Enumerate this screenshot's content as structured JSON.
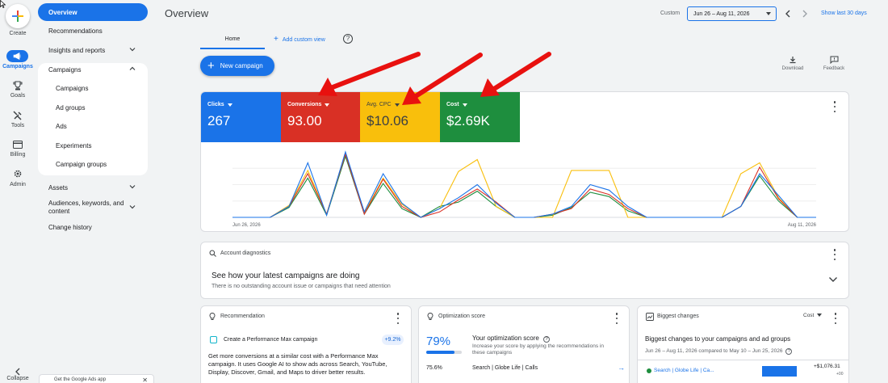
{
  "rail": {
    "create_label": "Create",
    "items": [
      {
        "label": "Campaigns",
        "icon": "megaphone-icon",
        "active": true
      },
      {
        "label": "Goals",
        "icon": "trophy-icon"
      },
      {
        "label": "Tools",
        "icon": "tools-icon"
      },
      {
        "label": "Billing",
        "icon": "credit-card-icon"
      },
      {
        "label": "Admin",
        "icon": "gear-icon"
      }
    ],
    "collapse_label": "Collapse"
  },
  "nav": {
    "overview": "Overview",
    "recommendations": "Recommendations",
    "insights": "Insights and reports",
    "campaigns_group": "Campaigns",
    "campaigns_sub": [
      "Campaigns",
      "Ad groups",
      "Ads",
      "Experiments",
      "Campaign groups"
    ],
    "assets": "Assets",
    "audiences": "Audiences, keywords, and content",
    "change_history": "Change history",
    "promo": "Get the Google Ads app"
  },
  "header": {
    "title": "Overview",
    "custom_label": "Custom",
    "date_range": "Jun 26 – Aug 11, 2026",
    "show_last": "Show last 30 days"
  },
  "tabs": {
    "home": "Home",
    "add_custom_view": "Add custom view"
  },
  "actions": {
    "new_campaign": "New campaign",
    "download": "Download",
    "feedback": "Feedback"
  },
  "metrics": [
    {
      "label": "Clicks",
      "value": "267",
      "color": "#1a73e8",
      "text_color": "#ffffff"
    },
    {
      "label": "Conversions",
      "value": "93.00",
      "color": "#d93025",
      "text_color": "#ffffff"
    },
    {
      "label": "Avg. CPC",
      "value": "$10.06",
      "color": "#f9bf0c",
      "text_color": "#3c4043"
    },
    {
      "label": "Cost",
      "value": "$2.69K",
      "color": "#1e8e3e",
      "text_color": "#ffffff"
    }
  ],
  "chart_data": {
    "type": "line",
    "x_start_label": "Jun 26, 2026",
    "x_end_label": "Aug 11, 2026",
    "grid": true,
    "series": [
      {
        "name": "Clicks",
        "color": "#1a73e8",
        "values": [
          0,
          0,
          0,
          1,
          5,
          0.2,
          6,
          0.5,
          4,
          1.3,
          0,
          0.8,
          1.8,
          3,
          1.3,
          0,
          0,
          0.3,
          1,
          3,
          2.5,
          1,
          0,
          0,
          0,
          0,
          0,
          1,
          4,
          2,
          0,
          0
        ]
      },
      {
        "name": "Conversions",
        "color": "#d93025",
        "values": [
          0,
          0,
          0,
          1,
          4,
          0.3,
          5.8,
          0.3,
          3.5,
          1,
          0,
          0.5,
          1.6,
          2.6,
          1.4,
          0,
          0,
          0.3,
          0.8,
          2.6,
          2.1,
          0.8,
          0,
          0,
          0,
          0,
          0,
          1,
          4.6,
          1.7,
          0,
          0
        ]
      },
      {
        "name": "Avg. CPC",
        "color": "#f9bf0c",
        "values": [
          0,
          0,
          0,
          1.1,
          4.3,
          0.3,
          5.9,
          0.4,
          3.6,
          1.2,
          0,
          0.8,
          4.2,
          5.3,
          1,
          0,
          0,
          0,
          4.3,
          4.3,
          4.3,
          0,
          0,
          0,
          0,
          0,
          0,
          4,
          5,
          1.8,
          0,
          0
        ]
      },
      {
        "name": "Cost",
        "color": "#1e8e3e",
        "values": [
          0,
          0,
          0,
          0.9,
          3.6,
          0.2,
          5.6,
          0.3,
          3.1,
          0.8,
          0,
          1,
          1.4,
          2.4,
          1,
          0,
          0,
          0.2,
          0.9,
          2.3,
          1.9,
          0.6,
          0,
          0,
          0,
          0,
          0,
          1,
          3.8,
          1.5,
          0,
          0
        ]
      }
    ]
  },
  "diagnostics": {
    "title": "Account diagnostics",
    "headline": "See how your latest campaigns are doing",
    "sub": "There is no outstanding account issue or campaigns that need attention"
  },
  "recommendation": {
    "title": "Recommendation",
    "item": "Create a Performance Max campaign",
    "badge": "+9.2%",
    "body": "Get more conversions at a similar cost with a Performance Max campaign. It uses Google AI to show ads across Search, YouTube, Display, Discover, Gmail, and Maps to driver better results."
  },
  "optimization": {
    "title": "Optimization score",
    "score": "79%",
    "score_fraction": 0.79,
    "heading": "Your optimization score",
    "desc": "Increase your score by applying the recommendations in these campaigns",
    "row_value": "75.6%",
    "row_label": "Search | Globe Life | Calls"
  },
  "changes": {
    "title": "Biggest changes",
    "dropdown": "Cost",
    "heading": "Biggest changes to your campaigns and ad groups",
    "compare": "Jun 26 – Aug 11, 2026 compared to May 10 – Jun 25, 2026",
    "row_label": "Search | Globe Life | Ca...",
    "row_value": "+$1,076.31",
    "row_sub": "+00"
  }
}
